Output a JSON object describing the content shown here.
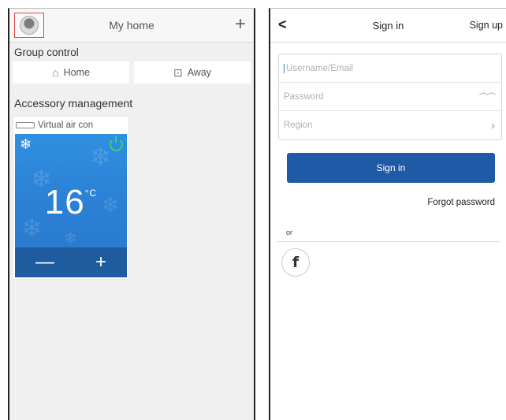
{
  "left": {
    "header": {
      "title": "My home",
      "add_symbol": "+"
    },
    "group_control": {
      "label": "Group control",
      "modes": [
        {
          "label": "Home",
          "icon": "home-icon"
        },
        {
          "label": "Away",
          "icon": "suitcase-icon"
        }
      ]
    },
    "accessory": {
      "label": "Accessory management",
      "device": {
        "name": "Virtual air con",
        "mode_icon": "snowflake-icon",
        "power_color": "#3ed26e",
        "temperature": "16",
        "unit": "°C",
        "minus": "—",
        "plus": "+"
      }
    }
  },
  "right": {
    "header": {
      "back": "<",
      "title": "Sign in",
      "signup": "Sign up"
    },
    "form": {
      "username_placeholder": "Username/Email",
      "password_placeholder": "Password",
      "region_placeholder": "Region"
    },
    "signin_button": "Sign in",
    "forgot_password": "Forgot password",
    "or": "or",
    "social": {
      "facebook_glyph": "f"
    }
  },
  "colors": {
    "primary": "#1e5aa5",
    "panel_blue": "#2b7fd4",
    "panel_dark": "#1f5c9f",
    "highlight": "#e04848"
  }
}
